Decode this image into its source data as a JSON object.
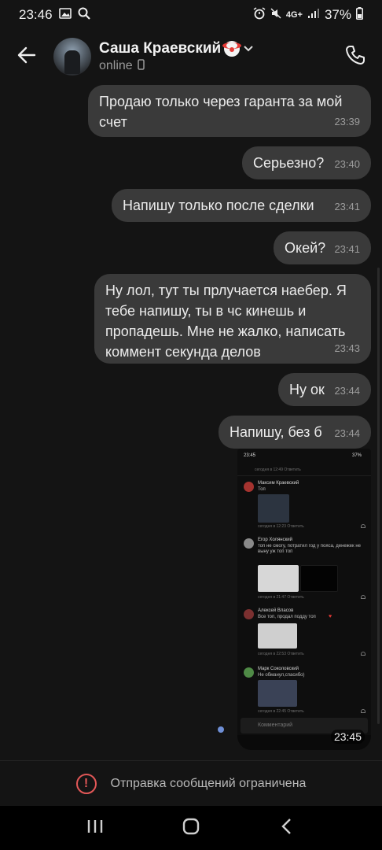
{
  "status_bar": {
    "time": "23:46",
    "network": "4G+",
    "battery": "37%"
  },
  "header": {
    "contact_name": "Саша Краевский",
    "status": "online"
  },
  "messages": [
    {
      "text": "Продаю только через гаранта за мой счет",
      "time": "23:39"
    },
    {
      "text": "Серьезно?",
      "time": "23:40"
    },
    {
      "text": "Напишу только после сделки",
      "time": "23:41"
    },
    {
      "text": "Окей?",
      "time": "23:41"
    },
    {
      "text": "Ну лол, тут ты прлучается наебер. Я тебе напишу, ты в чс кинешь и пропадешь. Мне не жалко, написать коммент секунда делов",
      "time": "23:43"
    },
    {
      "text": "Ну ок",
      "time": "23:44"
    },
    {
      "text": "Напишу, без б",
      "time": "23:44"
    }
  ],
  "image_message": {
    "time": "23:45",
    "inner": {
      "status_time": "23:45",
      "status_battery": "37%",
      "input_placeholder": "Комментарий",
      "comments": [
        {
          "name": "Максим Краевский",
          "text": "Топ",
          "meta": "сегодня в 12:23  Ответить"
        },
        {
          "name": "Егор Холянский",
          "text": "топ не смогу, потратил год у пояса, денежек не выну уж топ топ",
          "meta": "сегодня в 21:47  Ответить"
        },
        {
          "name": "Алексей Власов",
          "text": "Все топ, продал подду топ ",
          "meta": "сегодня в 22:53  Ответить"
        },
        {
          "name": "Марк Соколовский",
          "text": "Не обманул,спасибо)",
          "meta": "сегодня в 22:45  Ответить"
        }
      ],
      "top_meta": "сегодня в 12:49  Ответить"
    }
  },
  "footer": {
    "restricted_text": "Отправка сообщений ограничена"
  },
  "colors": {
    "background": "#141414",
    "bubble": "#3a3a3a",
    "restrict_accent": "#e25757"
  }
}
